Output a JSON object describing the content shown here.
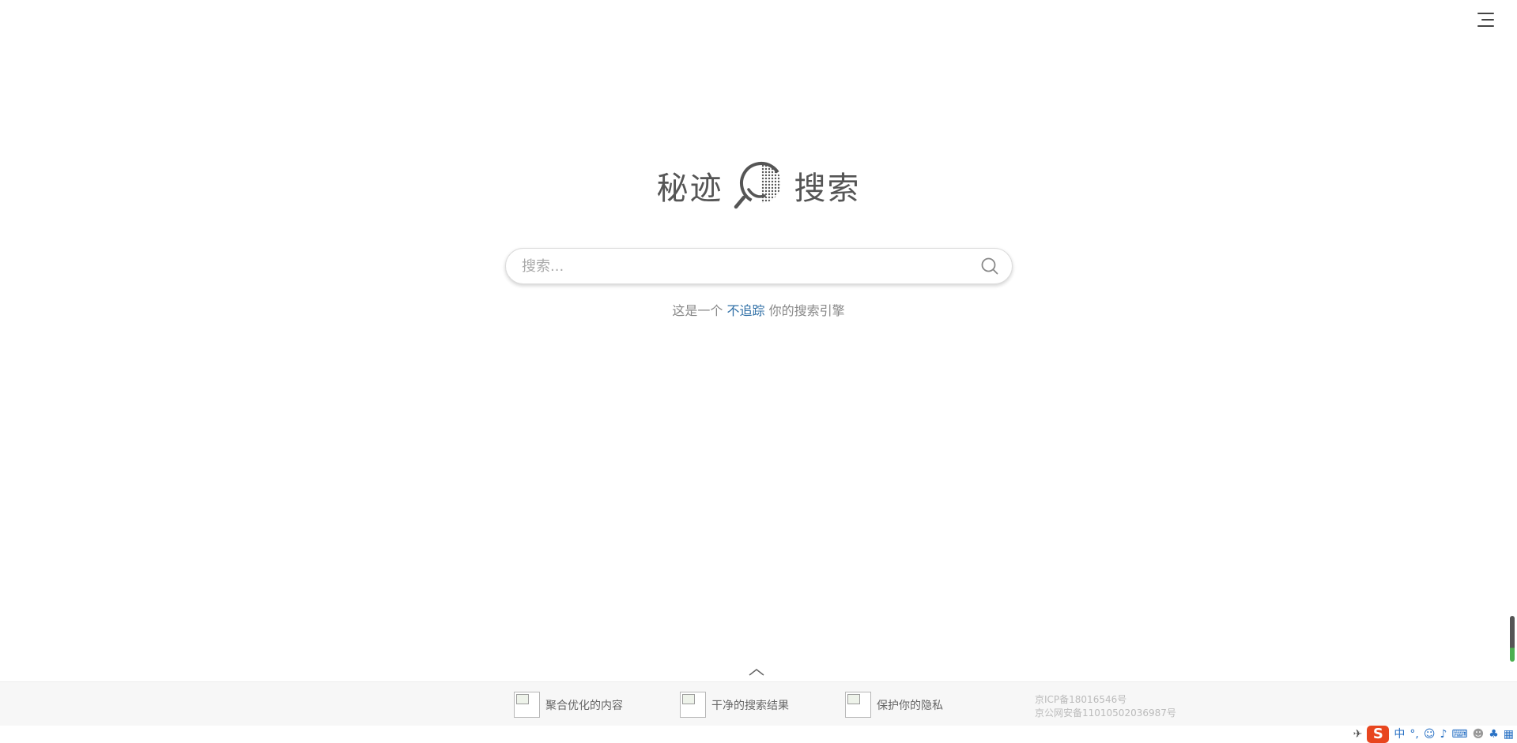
{
  "header": {
    "menu_icon": "hamburger-menu-icon"
  },
  "logo": {
    "left_text": "秘迹",
    "right_text": "搜索",
    "mark_icon": "smile-magnifier-logo-icon"
  },
  "search": {
    "placeholder": "搜索...",
    "value": "",
    "button_icon": "search-icon"
  },
  "tagline": {
    "prefix": "这是一个",
    "highlight": "不追踪",
    "suffix": "你的搜索引擎"
  },
  "footer": {
    "features": [
      {
        "label": "聚合优化的内容"
      },
      {
        "label": "干净的搜索结果"
      },
      {
        "label": "保护你的隐私"
      }
    ],
    "icp_line1": "京ICP备18016546号",
    "icp_line2": "京公网安备11010502036987号"
  },
  "taskbar": {
    "ime_zh": "中",
    "ime_punct": "°,",
    "sogou": "S"
  },
  "colors": {
    "accent_link": "#2f6fa6",
    "sogou": "#e8461f"
  }
}
